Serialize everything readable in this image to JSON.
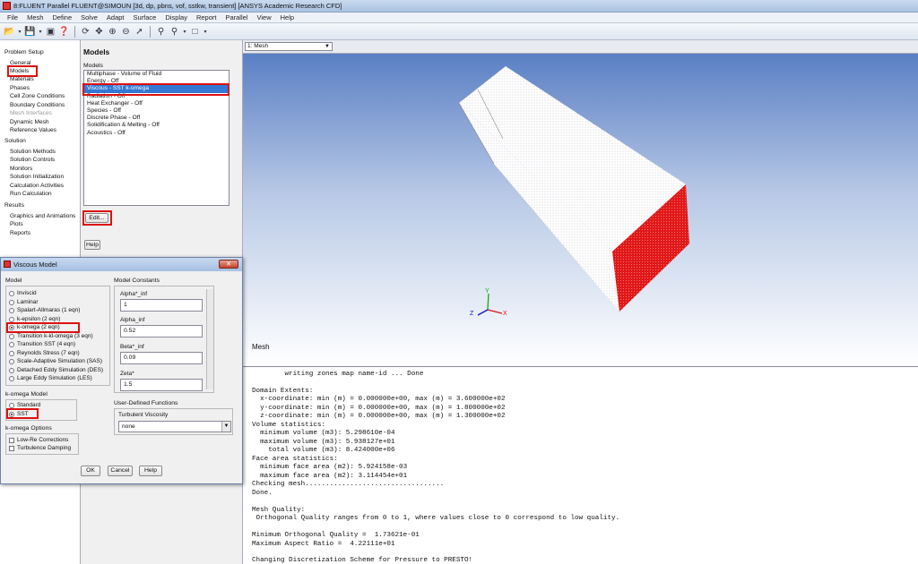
{
  "window": {
    "title": "8:FLUENT Parallel FLUENT@SIMOUN [3d, dp, pbns, vof, sstkw, transient] [ANSYS Academic Research CFD]"
  },
  "menu": [
    "File",
    "Mesh",
    "Define",
    "Solve",
    "Adapt",
    "Surface",
    "Display",
    "Report",
    "Parallel",
    "View",
    "Help"
  ],
  "toolbar_icons": [
    "open-folder-icon",
    "dropdown-arrow-icon",
    "save-icon",
    "dropdown-arrow-icon",
    "screenshot-icon",
    "help-icon",
    "rotate-icon",
    "pan-icon",
    "zoom-in-icon",
    "zoom-out-icon",
    "probe-icon",
    "zoom-fit-icon",
    "zoom-box-icon",
    "dropdown-arrow-icon",
    "layout-icon",
    "dropdown-arrow-icon"
  ],
  "nav": {
    "problem_setup": "Problem Setup",
    "general": "General",
    "models": "Models",
    "materials": "Materials",
    "phases": "Phases",
    "cell_zone": "Cell Zone Conditions",
    "boundary": "Boundary Conditions",
    "mesh_interfaces": "Mesh Interfaces",
    "dynamic_mesh": "Dynamic Mesh",
    "reference_values": "Reference Values",
    "solution": "Solution",
    "solution_methods": "Solution Methods",
    "solution_controls": "Solution Controls",
    "monitors": "Monitors",
    "solution_init": "Solution Initialization",
    "calc_activities": "Calculation Activities",
    "run_calc": "Run Calculation",
    "results": "Results",
    "graphics": "Graphics and Animations",
    "plots": "Plots",
    "reports": "Reports"
  },
  "models_panel": {
    "title": "Models",
    "list_label": "Models",
    "items": [
      "Multiphase - Volume of Fluid",
      "Energy - Off",
      "Viscous - SST k-omega",
      "Radiation - Off",
      "Heat Exchanger - Off",
      "Species - Off",
      "Discrete Phase - Off",
      "Solidification & Melting - Off",
      "Acoustics - Off"
    ],
    "edit_button": "Edit...",
    "help_button": "Help"
  },
  "viewport": {
    "view_select": "1: Mesh",
    "label": "Mesh",
    "axes": {
      "x": "X",
      "y": "Y",
      "z": "Z"
    }
  },
  "dialog": {
    "title": "Viscous Model",
    "model_label": "Model",
    "models": [
      "Inviscid",
      "Laminar",
      "Spalart-Allmaras (1 eqn)",
      "k-epsilon (2 eqn)",
      "k-omega (2 eqn)",
      "Transition k-kl-omega (3 eqn)",
      "Transition SST (4 eqn)",
      "Reynolds Stress (7 eqn)",
      "Scale-Adaptive Simulation (SAS)",
      "Detached Eddy Simulation (DES)",
      "Large Eddy Simulation (LES)"
    ],
    "selected_model": "k-omega (2 eqn)",
    "komega_model_label": "k-omega Model",
    "komega_models": [
      "Standard",
      "SST"
    ],
    "selected_komega": "SST",
    "komega_options_label": "k-omega Options",
    "options": [
      "Low-Re Corrections",
      "Turbulence Damping"
    ],
    "constants_label": "Model Constants",
    "constants": [
      {
        "name": "Alpha*_inf",
        "value": "1"
      },
      {
        "name": "Alpha_inf",
        "value": "0.52"
      },
      {
        "name": "Beta*_inf",
        "value": "0.09"
      },
      {
        "name": "Zeta*",
        "value": "1.5"
      }
    ],
    "udf_label": "User-Defined Functions",
    "turb_visc_label": "Turbulent Viscosity",
    "turb_visc_value": "none",
    "ok": "OK",
    "cancel": "Cancel",
    "help": "Help"
  },
  "console": [
    "        writing zones map name-id ... Done",
    "",
    "Domain Extents:",
    "  x-coordinate: min (m) = 0.000000e+00, max (m) = 3.600000e+02",
    "  y-coordinate: min (m) = 0.000000e+00, max (m) = 1.800000e+02",
    "  z-coordinate: min (m) = 0.000000e+00, max (m) = 1.300000e+02",
    "Volume statistics:",
    "  minimum volume (m3): 5.298610e-04",
    "  maximum volume (m3): 5.938127e+01",
    "    total volume (m3): 8.424000e+06",
    "Face area statistics:",
    "  minimum face area (m2): 5.924158e-03",
    "  maximum face area (m2): 3.114454e+01",
    "Checking mesh..................................",
    "Done.",
    "",
    "Mesh Quality:",
    " Orthogonal Quality ranges from 0 to 1, where values close to 0 correspond to low quality.",
    "",
    "Minimum Orthogonal Quality =  1.73621e-01",
    "Maximum Aspect Ratio =  4.22111e+01",
    "",
    "Changing Discretization Scheme for Pressure to PRESTO!"
  ]
}
